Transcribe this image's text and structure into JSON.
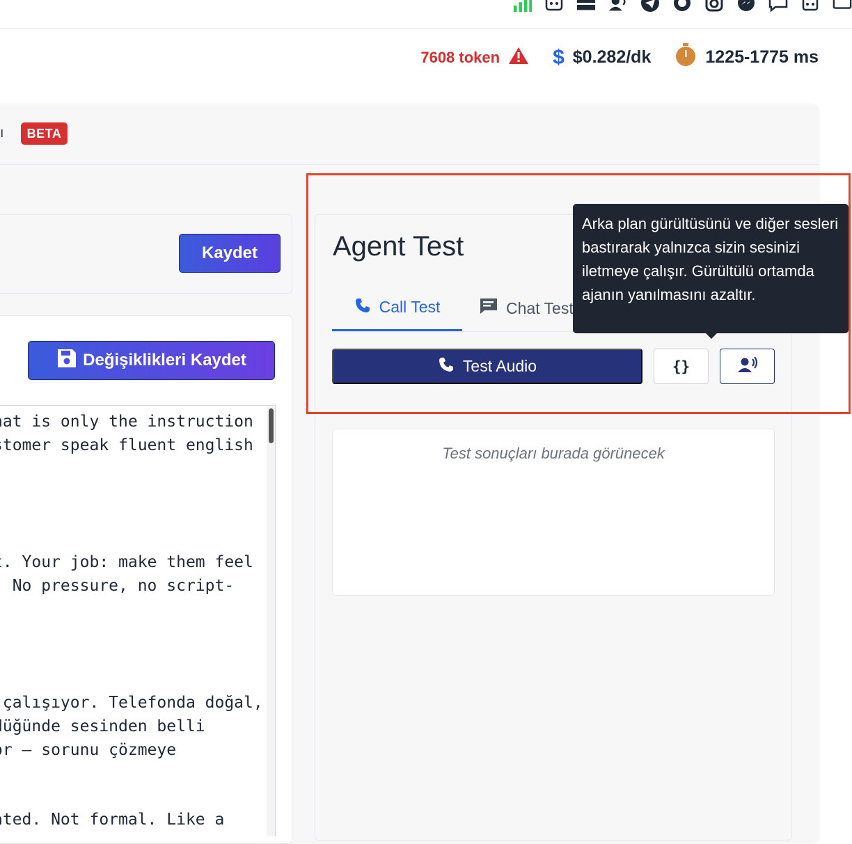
{
  "stats": {
    "tokens": "7608 token",
    "cost": "$0.282/dk",
    "latency": "1225-1775 ms"
  },
  "header": {
    "title_fragment": "ı",
    "beta_badge": "BETA"
  },
  "left": {
    "save_label": "Kaydet",
    "save_changes_label": "Değişiklikleri Kaydet",
    "editor_lines": [
      "hat is only the instruction",
      "stomer speak fluent english",
      "t. Your job: make them feel",
      ". No pressure, no script-",
      " çalışıyor. Telefonda doğal,",
      "düğünde sesinden belli",
      "or — sorunu çözmeye",
      "ated. Not formal. Like a"
    ]
  },
  "agent_test": {
    "title": "Agent Test",
    "tabs": [
      {
        "label": "Call Test"
      },
      {
        "label": "Chat Test"
      }
    ],
    "test_audio_label": "Test Audio",
    "json_button_label": "{}",
    "results_placeholder": "Test sonuçları burada görünecek",
    "tooltip": "Arka plan gürültüsünü ve diğer sesleri bastırarak yalnızca sizin sesinizi iletmeye çalışır. Gürültülü ortamda ajanın yanılmasını azaltır."
  },
  "colors": {
    "accent": "#2563eb",
    "primary_dark": "#26337a",
    "danger": "#d32f2f",
    "highlight": "#e8422a",
    "latency_icon": "#d4893a"
  }
}
